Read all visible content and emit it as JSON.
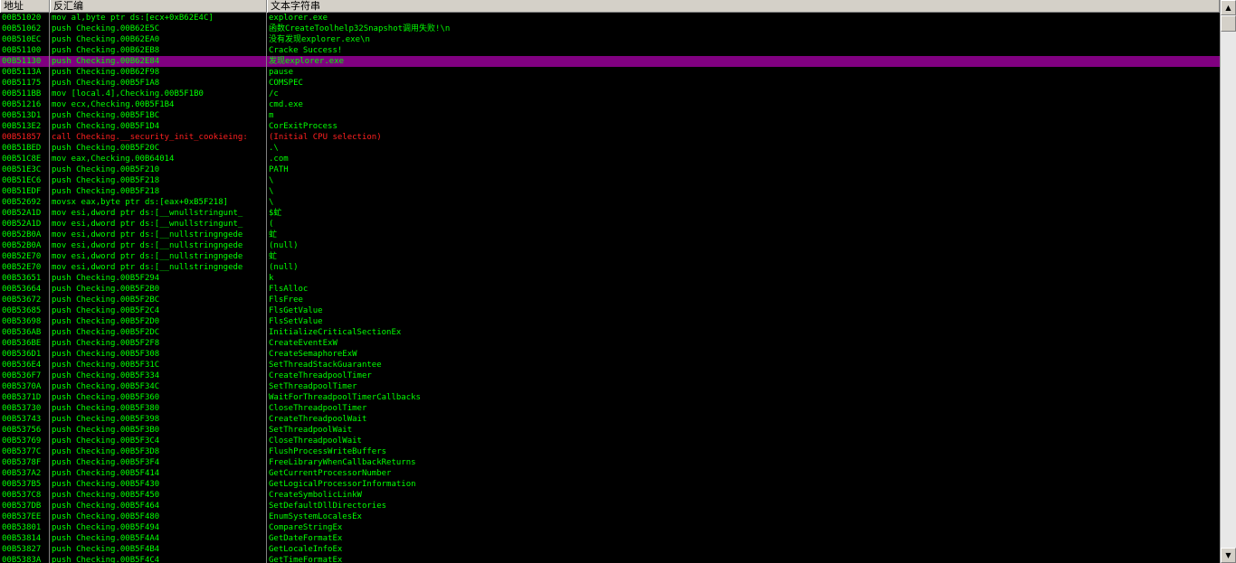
{
  "header": {
    "address": "地址",
    "disassembly": "反汇编",
    "text_string": "文本字符串"
  },
  "scroll": {
    "up_icon": "▲",
    "down_icon": "▼"
  },
  "colors": {
    "text": "#00ff00",
    "selected_bg": "#800080",
    "highlight": "#ff2020"
  },
  "rows": [
    {
      "addr": "00B51020",
      "dis": "mov al,byte ptr ds:[ecx+0xB62E4C]",
      "str": "explorer.exe"
    },
    {
      "addr": "00B51062",
      "dis": "push Checking.00B62E5C",
      "str": "函数CreateToolhelp32Snapshot调用失败!\\n"
    },
    {
      "addr": "00B510EC",
      "dis": "push Checking.00B62EA0",
      "str": "没有发现explorer.exe\\n"
    },
    {
      "addr": "00B51100",
      "dis": "push Checking.00B62EB8",
      "str": "Cracke Success!"
    },
    {
      "addr": "00B51130",
      "dis": "push Checking.00B62E84",
      "str": "发现explorer.exe",
      "selected": true
    },
    {
      "addr": "00B5113A",
      "dis": "push Checking.00B62F98",
      "str": "pause"
    },
    {
      "addr": "00B51175",
      "dis": "push Checking.00B5F1A8",
      "str": "COMSPEC"
    },
    {
      "addr": "00B511BB",
      "dis": "mov [local.4],Checking.00B5F1B0",
      "str": "/c"
    },
    {
      "addr": "00B51216",
      "dis": "mov ecx,Checking.00B5F1B4",
      "str": "cmd.exe"
    },
    {
      "addr": "00B513D1",
      "dis": "push Checking.00B5F1BC",
      "str": "m"
    },
    {
      "addr": "00B513E2",
      "dis": "push Checking.00B5F1D4",
      "str": "CorExitProcess"
    },
    {
      "addr": "00B51857",
      "dis": "call Checking.__security_init_cookieing:",
      "str": "(Initial CPU selection)",
      "red": true
    },
    {
      "addr": "00B51BED",
      "dis": "push Checking.00B5F20C",
      "str": ".\\"
    },
    {
      "addr": "00B51C8E",
      "dis": "mov eax,Checking.00B64014",
      "str": ".com"
    },
    {
      "addr": "00B51E3C",
      "dis": "push Checking.00B5F210",
      "str": "PATH"
    },
    {
      "addr": "00B51EC6",
      "dis": "push Checking.00B5F218",
      "str": "\\"
    },
    {
      "addr": "00B51EDF",
      "dis": "push Checking.00B5F218",
      "str": "\\"
    },
    {
      "addr": "00B52692",
      "dis": "movsx eax,byte ptr ds:[eax+0xB5F218]",
      "str": "\\"
    },
    {
      "addr": "00B52A1D",
      "dis": "mov esi,dword ptr ds:[__wnullstringunt_",
      "str": "$虻"
    },
    {
      "addr": "00B52A1D",
      "dis": "mov esi,dword ptr ds:[__wnullstringunt_",
      "str": "("
    },
    {
      "addr": "00B52B0A",
      "dis": "mov esi,dword ptr ds:[__nullstringngede",
      "str": "虻"
    },
    {
      "addr": "00B52B0A",
      "dis": "mov esi,dword ptr ds:[__nullstringngede",
      "str": "(null)"
    },
    {
      "addr": "00B52E70",
      "dis": "mov esi,dword ptr ds:[__nullstringngede",
      "str": "虻"
    },
    {
      "addr": "00B52E70",
      "dis": "mov esi,dword ptr ds:[__nullstringngede",
      "str": "(null)"
    },
    {
      "addr": "00B53651",
      "dis": "push Checking.00B5F294",
      "str": "k"
    },
    {
      "addr": "00B53664",
      "dis": "push Checking.00B5F2B0",
      "str": "FlsAlloc"
    },
    {
      "addr": "00B53672",
      "dis": "push Checking.00B5F2BC",
      "str": "FlsFree"
    },
    {
      "addr": "00B53685",
      "dis": "push Checking.00B5F2C4",
      "str": "FlsGetValue"
    },
    {
      "addr": "00B53698",
      "dis": "push Checking.00B5F2D0",
      "str": "FlsSetValue"
    },
    {
      "addr": "00B536AB",
      "dis": "push Checking.00B5F2DC",
      "str": "InitializeCriticalSectionEx"
    },
    {
      "addr": "00B536BE",
      "dis": "push Checking.00B5F2F8",
      "str": "CreateEventExW"
    },
    {
      "addr": "00B536D1",
      "dis": "push Checking.00B5F308",
      "str": "CreateSemaphoreExW"
    },
    {
      "addr": "00B536E4",
      "dis": "push Checking.00B5F31C",
      "str": "SetThreadStackGuarantee"
    },
    {
      "addr": "00B536F7",
      "dis": "push Checking.00B5F334",
      "str": "CreateThreadpoolTimer"
    },
    {
      "addr": "00B5370A",
      "dis": "push Checking.00B5F34C",
      "str": "SetThreadpoolTimer"
    },
    {
      "addr": "00B5371D",
      "dis": "push Checking.00B5F360",
      "str": "WaitForThreadpoolTimerCallbacks"
    },
    {
      "addr": "00B53730",
      "dis": "push Checking.00B5F380",
      "str": "CloseThreadpoolTimer"
    },
    {
      "addr": "00B53743",
      "dis": "push Checking.00B5F398",
      "str": "CreateThreadpoolWait"
    },
    {
      "addr": "00B53756",
      "dis": "push Checking.00B5F3B0",
      "str": "SetThreadpoolWait"
    },
    {
      "addr": "00B53769",
      "dis": "push Checking.00B5F3C4",
      "str": "CloseThreadpoolWait"
    },
    {
      "addr": "00B5377C",
      "dis": "push Checking.00B5F3D8",
      "str": "FlushProcessWriteBuffers"
    },
    {
      "addr": "00B5378F",
      "dis": "push Checking.00B5F3F4",
      "str": "FreeLibraryWhenCallbackReturns"
    },
    {
      "addr": "00B537A2",
      "dis": "push Checking.00B5F414",
      "str": "GetCurrentProcessorNumber"
    },
    {
      "addr": "00B537B5",
      "dis": "push Checking.00B5F430",
      "str": "GetLogicalProcessorInformation"
    },
    {
      "addr": "00B537C8",
      "dis": "push Checking.00B5F450",
      "str": "CreateSymbolicLinkW"
    },
    {
      "addr": "00B537DB",
      "dis": "push Checking.00B5F464",
      "str": "SetDefaultDllDirectories"
    },
    {
      "addr": "00B537EE",
      "dis": "push Checking.00B5F480",
      "str": "EnumSystemLocalesEx"
    },
    {
      "addr": "00B53801",
      "dis": "push Checking.00B5F494",
      "str": "CompareStringEx"
    },
    {
      "addr": "00B53814",
      "dis": "push Checking.00B5F4A4",
      "str": "GetDateFormatEx"
    },
    {
      "addr": "00B53827",
      "dis": "push Checking.00B5F4B4",
      "str": "GetLocaleInfoEx"
    },
    {
      "addr": "00B5383A",
      "dis": "push Checking.00B5F4C4",
      "str": "GetTimeFormatEx"
    }
  ]
}
